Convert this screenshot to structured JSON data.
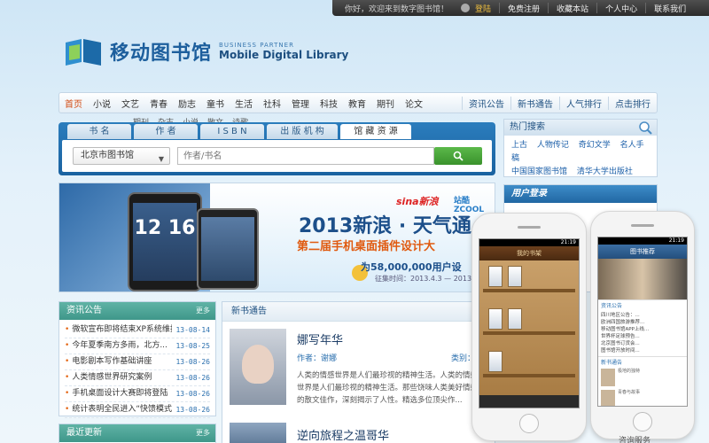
{
  "topbar": {
    "welcome": "你好，欢迎来到数字图书馆！",
    "login": "登陆",
    "register": "免费注册",
    "bookmark": "收藏本站",
    "personal": "个人中心",
    "contact": "联系我们"
  },
  "logo": {
    "cn": "移动图书馆",
    "partner": "BUSINESS PARTNER",
    "en": "Mobile Digital Library"
  },
  "nav": {
    "categories": [
      "首页",
      "小说",
      "文艺",
      "青春",
      "励志",
      "童书",
      "生活",
      "社科",
      "管理",
      "科技",
      "教育",
      "期刊",
      "论文"
    ],
    "right_links": [
      "资讯公告",
      "新书通告",
      "人气排行",
      "点击排行"
    ],
    "subnav": [
      "期刊",
      "杂志",
      "小说",
      "散文",
      "诗歌"
    ]
  },
  "search": {
    "tabs": [
      "书 名",
      "作 者",
      "I S B N",
      "出 版 机 构",
      "馆 藏 资 源"
    ],
    "library": "北京市图书馆",
    "placeholder": "作者/书名"
  },
  "hot": {
    "title": "热门搜索",
    "links_row1": [
      "上古",
      "人物传记",
      "奇幻文学",
      "名人手稿"
    ],
    "links_row2": [
      "中国国家图书馆",
      "清华大学出版社"
    ]
  },
  "banner": {
    "sina": "sina新浪",
    "zcool": "站酷ZCOOL",
    "title": "2013新浪 · 天气通",
    "subtitle": "第二届手机桌面插件设计大",
    "users": "为58,000,000用户设",
    "date": "征集时间：2013.4.3 — 2013.5",
    "clock": "12 16"
  },
  "login_panel": {
    "title": "用户登录"
  },
  "news": {
    "title": "资讯公告",
    "more": "更多",
    "items": [
      {
        "title": "微软宣布即将结束XP系统维护",
        "date": "13-08-14"
      },
      {
        "title": "今年夏季南方多雨，北方...",
        "date": "13-08-25"
      },
      {
        "title": "电影剧本写作基础讲座",
        "date": "13-08-26"
      },
      {
        "title": "人类情感世界研究案例",
        "date": "13-08-26"
      },
      {
        "title": "手机桌面设计大赛即将登陆",
        "date": "13-08-26"
      },
      {
        "title": "统计表明全民进入“快馈模式”",
        "date": "13-08-26"
      }
    ]
  },
  "recent": {
    "title": "最近更新",
    "more": "更多"
  },
  "books": {
    "title": "新书通告",
    "book1": {
      "title": "娜写年华",
      "author": "作者：谢娜",
      "category": "类别：",
      "desc": "人类的情感世界是人们最珍视的精神生活。人类的情感世界是人们最珍视的精神生活。那些饶味人类美好情感的散文佳作，深刻揭示了人性。精选多位顶尖作..."
    },
    "book2": {
      "title": "逆向旅程之温哥华"
    }
  },
  "phone_left": {
    "time": "21:19",
    "header": "我的书架"
  },
  "phone_right": {
    "time": "21:19",
    "header": "图书推荐",
    "section1": "资讯公告",
    "lines": [
      "四川地区公告：...",
      "欧洲四国旅游推荐...",
      "移动图书馆APP上线...",
      "世界杯足球预告...",
      "北京图书订货会...",
      "图书馆开放时间..."
    ],
    "section2": "新书通告",
    "book_a": "极地的独特",
    "book_b": "青春与故事",
    "below": "咨询服务"
  },
  "colors": {
    "accent": "#1d5f9d",
    "nav_active": "#d24a12",
    "search_blue": "#1a62a0",
    "news_green": "#3f978a",
    "date_blue": "#2a6fae"
  }
}
